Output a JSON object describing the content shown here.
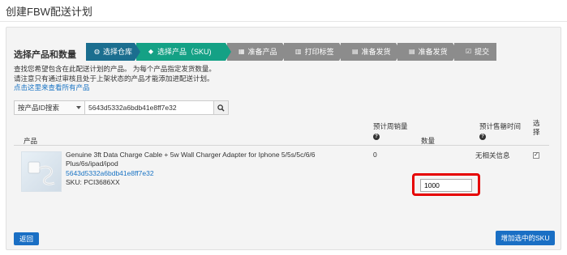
{
  "page": {
    "title": "创建FBW配送计划"
  },
  "steps": [
    {
      "label": "选择仓库",
      "icon": "globe-icon",
      "state": "done"
    },
    {
      "label": "选择产品（SKU)",
      "icon": "tag-icon",
      "state": "active"
    },
    {
      "label": "准备产品",
      "icon": "grid-icon",
      "state": "pending"
    },
    {
      "label": "打印标签",
      "icon": "barcode-icon",
      "state": "pending"
    },
    {
      "label": "准备发货",
      "icon": "list-icon",
      "state": "pending"
    },
    {
      "label": "准备发货",
      "icon": "list-icon",
      "state": "pending"
    },
    {
      "label": "提交",
      "icon": "check-square-icon",
      "state": "pending"
    }
  ],
  "section": {
    "title": "选择产品和数量",
    "desc_line1": "查找您希望包含在此配送计划的产品。 为每个产品指定发货数量。",
    "desc_line2": "请注意只有通过审核且处于上架状态的产品才能添加进配送计划。",
    "view_all_link": "点击这里来查看所有产品"
  },
  "search": {
    "mode_selected": "按产品ID搜索",
    "value": "5643d5332a6bdb41e8ff7e32"
  },
  "table": {
    "headers": {
      "product": "产品",
      "weekly_sales": "预计周销量",
      "quantity": "数量",
      "sellout_time": "预计售罄时间",
      "select": "选择"
    },
    "rows": [
      {
        "name": "Genuine 3ft Data Charge Cable + 5w Wall Charger Adapter for Iphone 5/5s/5c/6/6 Plus/6s/ipad/ipod",
        "product_id": "5643d5332a6bdb41e8ff7e32",
        "sku": "SKU: PCI3686XX",
        "weekly_sales": "0",
        "quantity": "1000",
        "sellout_time": "无相关信息",
        "selected": "✓"
      }
    ]
  },
  "buttons": {
    "back": "返回",
    "add_selected": "增加选中的SKU"
  },
  "colors": {
    "step_done": "#1b6e8f",
    "step_active": "#14a185",
    "step_pending": "#8c8c8c",
    "primary": "#1a6fc4",
    "highlight": "#e60000"
  }
}
